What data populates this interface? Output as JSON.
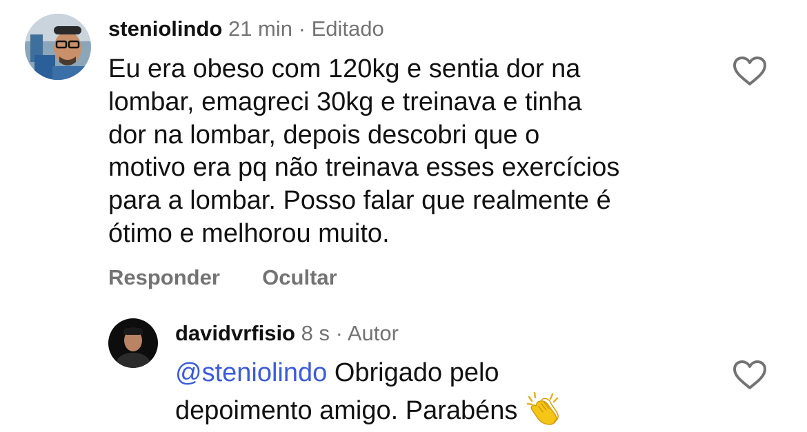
{
  "comments": [
    {
      "username": "steniolindo",
      "time": "21 min",
      "separator": "·",
      "tag": "Editado",
      "lines": [
        "Eu era obeso com 120kg e sentia dor na",
        "lombar, emagreci 30kg e treinava e tinha",
        "dor na lombar, depois descobri que o",
        "motivo era pq não treinava esses exercícios",
        "para a lombar. Posso falar que realmente é",
        "ótimo e melhorou muito."
      ],
      "actions": {
        "reply": "Responder",
        "hide": "Ocultar"
      },
      "like_icon": "heart-outline-icon"
    },
    {
      "username": "davidvrfisio",
      "time": "8 s",
      "separator": "·",
      "tag": "Autor",
      "mention": "@steniolindo",
      "line1_rest": " Obrigado pelo",
      "line2": "depoimento amigo. Parabéns ",
      "emoji": "clapping-hands-emoji",
      "like_icon": "heart-outline-icon"
    }
  ],
  "colors": {
    "text": "#111111",
    "secondary": "#737373",
    "mention": "#3b5bdb"
  }
}
